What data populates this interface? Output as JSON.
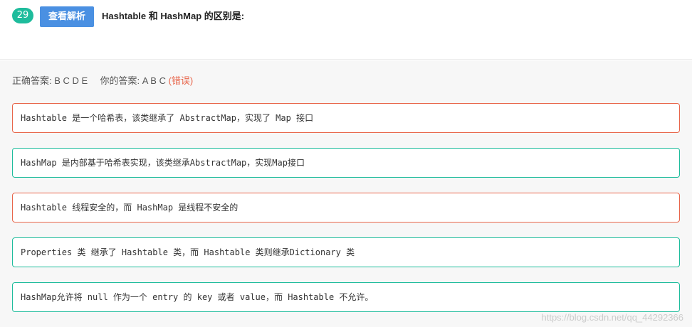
{
  "question": {
    "number": "29",
    "analysis_button": "查看解析",
    "title": "Hashtable 和 HashMap 的区别是:"
  },
  "answers": {
    "correct_label": "正确答案:",
    "correct_value": "B C D E",
    "yours_label": "你的答案:",
    "yours_value": "A B C",
    "status": "(错误)"
  },
  "options": [
    {
      "text": "Hashtable 是一个哈希表，该类继承了 AbstractMap，实现了 Map 接口",
      "state": "wrong"
    },
    {
      "text": "HashMap 是内部基于哈希表实现，该类继承AbstractMap，实现Map接口",
      "state": "correct"
    },
    {
      "text": "Hashtable 线程安全的，而 HashMap 是线程不安全的",
      "state": "wrong"
    },
    {
      "text": "Properties 类 继承了 Hashtable 类，而 Hashtable 类则继承Dictionary 类",
      "state": "correct"
    },
    {
      "text": "HashMap允许将 null 作为一个 entry 的 key 或者 value，而 Hashtable 不允许。",
      "state": "correct"
    }
  ],
  "watermark": "https://blog.csdn.net/qq_44292366",
  "colors": {
    "accent_green": "#1ebc9c",
    "button_blue": "#4a90e2",
    "wrong_red": "#e8654a"
  }
}
